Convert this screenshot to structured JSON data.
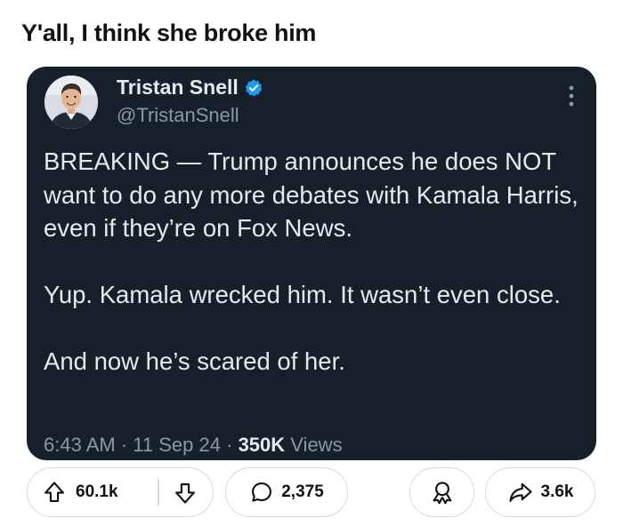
{
  "post": {
    "title": "Y'all, I think she broke him"
  },
  "tweet": {
    "author_name": "Tristan Snell",
    "handle": "@TristanSnell",
    "paragraphs": [
      "BREAKING — Trump announces he does NOT want to do any more debates with Kamala Harris, even if they’re on Fox News.",
      "Yup. Kamala wrecked him. It wasn’t even close.",
      "And now he’s scared of her."
    ],
    "time": "6:43 AM",
    "date": "11 Sep 24",
    "views_count": "350K",
    "views_label": "Views",
    "separator": "·",
    "verified_color": "#1d9bf0"
  },
  "actions": {
    "upvote_count": "60.1k",
    "comment_count": "2,375",
    "share_count": "3.6k"
  },
  "colors": {
    "card_background": "#15202b",
    "text_primary": "#e7e9ea",
    "text_secondary": "#8b98a5"
  },
  "icons": {
    "upvote": "upvote-arrow-icon",
    "downvote": "downvote-arrow-icon",
    "comment": "comment-bubble-icon",
    "award": "award-ribbon-icon",
    "share": "share-arrow-icon",
    "more": "more-vertical-icon",
    "verified": "verified-badge-icon"
  }
}
